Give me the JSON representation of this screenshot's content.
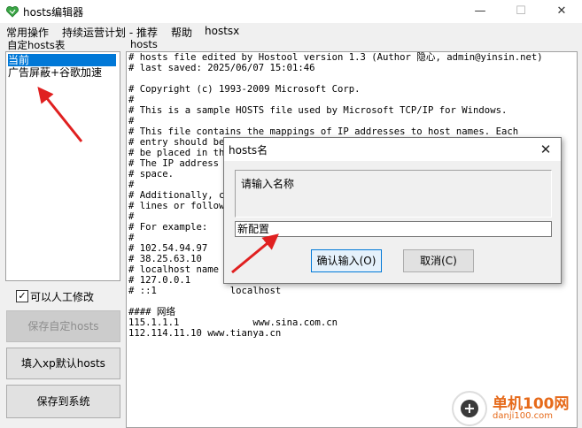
{
  "window": {
    "title": "hosts编辑器",
    "minimize": "—",
    "maximize": "☐",
    "close": "✕"
  },
  "menu": [
    "常用操作",
    "持续运营计划 - 推荐",
    "帮助",
    "hostsx"
  ],
  "left_panel": {
    "label": "自定hosts表",
    "items": [
      "当前",
      "广告屏蔽+谷歌加速"
    ],
    "selected_index": 0,
    "checkbox": {
      "label": "可以人工修改",
      "checked": true,
      "mark": "✓"
    },
    "buttons": {
      "save_custom": "保存自定hosts",
      "fill_xp": "填入xp默认hosts",
      "save_system": "保存到系统"
    }
  },
  "editor": {
    "label": "hosts",
    "content": "# hosts file edited by Hostool version 1.3 (Author 隐心, admin@yinsin.net)\n# last saved: 2025/06/07 15:01:46\n\n# Copyright (c) 1993-2009 Microsoft Corp.\n#\n# This is a sample HOSTS file used by Microsoft TCP/IP for Windows.\n#\n# This file contains the mappings of IP addresses to host names. Each\n# entry should be kept on an individual line. The IP address should\n# be placed in the first column followed by the corresponding host name.\n# The IP address and the host name should be separated by at least one\n# space.\n#\n# Additionally, comments (such as these) may be inserted on individual\n# lines or following the machine name denoted by a '#' symbol.\n#\n# For example:\n#\n# 102.54.94.97     rhino.acme.com          # source server\n# 38.25.63.10     x.acme.com              # x client host\n# localhost name resolution is handled within DNS itself.\n# 127.0.0.1       localhost\n# ::1             localhost\n\n#### 网络\n115.1.1.1             www.sina.com.cn\n112.114.11.10 www.tianya.cn"
  },
  "dialog": {
    "title": "hosts名",
    "prompt": "请输入名称",
    "input_value": "新配置",
    "ok": "确认输入(O)",
    "cancel": "取消(C)",
    "close": "✕"
  },
  "watermark": {
    "name": "单机100网",
    "url": "danji100.com",
    "logo": "+"
  },
  "colors": {
    "selection": "#0078d7",
    "arrow": "#e02020",
    "watermark": "#e66a1a"
  }
}
